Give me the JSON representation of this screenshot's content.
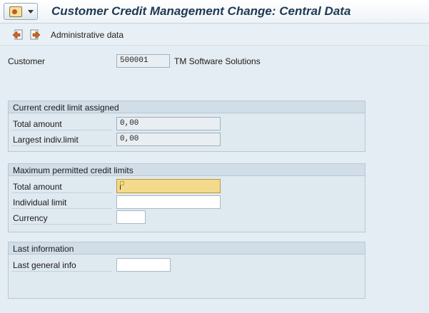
{
  "window": {
    "title": "Customer Credit Management Change: Central Data"
  },
  "toolbar": {
    "administrative_data_label": "Administrative data"
  },
  "customer": {
    "label": "Customer",
    "number": "500001",
    "name": "TM Software Solutions"
  },
  "current_limit": {
    "header": "Current credit limit assigned",
    "total_amount_label": "Total amount",
    "total_amount_value": "0,00",
    "largest_label": "Largest indiv.limit",
    "largest_value": "0,00"
  },
  "max_limits": {
    "header": "Maximum permitted credit limits",
    "total_amount_label": "Total amount",
    "total_amount_value": "",
    "individual_limit_label": "Individual limit",
    "individual_limit_value": "",
    "currency_label": "Currency",
    "currency_value": ""
  },
  "last_info": {
    "header": "Last information",
    "last_general_label": "Last general info",
    "last_general_value": ""
  },
  "icons": {
    "menu": "system-menu-icon",
    "prev": "previous-page-icon",
    "next": "next-page-icon"
  },
  "colors": {
    "background": "#e4edf3",
    "title_text": "#203a54",
    "active_field": "#f4da8c"
  }
}
